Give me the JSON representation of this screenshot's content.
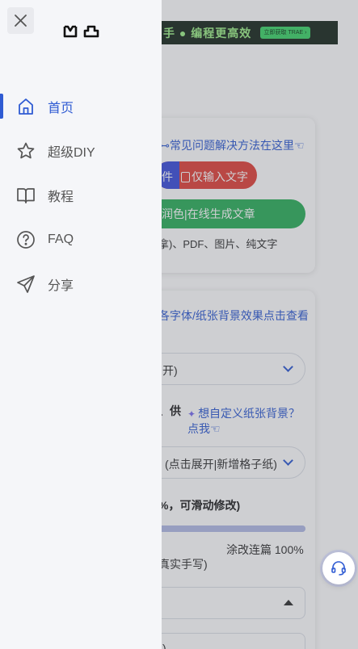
{
  "background": {
    "banner": {
      "text": "手 ● 编程更高效",
      "button": "立即获取 TRAE ›"
    },
    "faq_link": "⊷常见问题解决方法在这里☜",
    "mode_toggle": {
      "left": "件",
      "right": "仅输入文字"
    },
    "generate_button": "润色|在线生成文章",
    "formats": "拿)、PDF、图片、纯文字",
    "font_link": "各字体/纸张背景效果点击查看",
    "font_select": "开)",
    "supply_label": "、供",
    "custom_bg_link": "想自定义纸张背景？点我☜",
    "paper_select": "(点击展开|新增格子纸)",
    "percent_note": "%，可滑动修改)",
    "slider": {
      "value_percent": 100,
      "right_label": "涂改连篇 100%",
      "left_label": "真实手写)"
    },
    "bottom_select": ")"
  },
  "drawer": {
    "close_label": "×",
    "nav": [
      {
        "label": "首页",
        "icon": "home-icon",
        "active": true
      },
      {
        "label": "超级DIY",
        "icon": "star-icon",
        "active": false
      },
      {
        "label": "教程",
        "icon": "book-icon",
        "active": false
      },
      {
        "label": "FAQ",
        "icon": "question-icon",
        "active": false
      },
      {
        "label": "分享",
        "icon": "send-icon",
        "active": false
      }
    ]
  },
  "colors": {
    "accent": "#2f5bd3",
    "drawer_bg": "#f5f6f9",
    "green": "#2fb15c",
    "red": "#e2443c"
  }
}
